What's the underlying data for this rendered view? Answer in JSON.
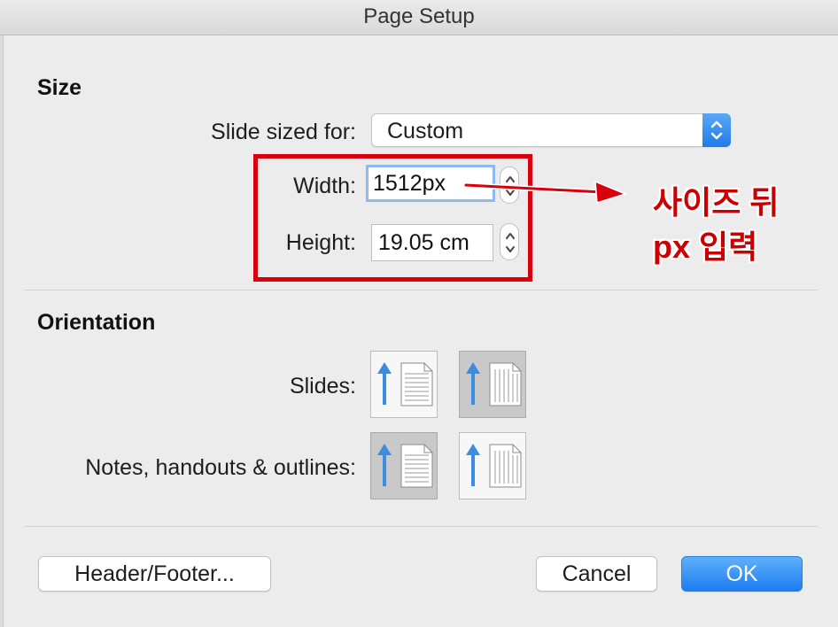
{
  "window": {
    "title": "Page Setup"
  },
  "size": {
    "section_title": "Size",
    "slide_sized_for_label": "Slide sized for:",
    "slide_sized_for_value": "Custom",
    "width_label": "Width:",
    "width_value": "1512px",
    "height_label": "Height:",
    "height_value": "19.05 cm"
  },
  "annotation": {
    "line1": "사이즈 뒤",
    "line2": "px 입력",
    "color": "#d8000c"
  },
  "orientation": {
    "section_title": "Orientation",
    "slides_label": "Slides:",
    "notes_label": "Notes, handouts & outlines:",
    "slides_selected": "landscape",
    "notes_selected": "portrait"
  },
  "buttons": {
    "header_footer": "Header/Footer...",
    "cancel": "Cancel",
    "ok": "OK"
  },
  "colors": {
    "accent": "#1d7cf2",
    "focus_ring": "#8dbaf1"
  }
}
